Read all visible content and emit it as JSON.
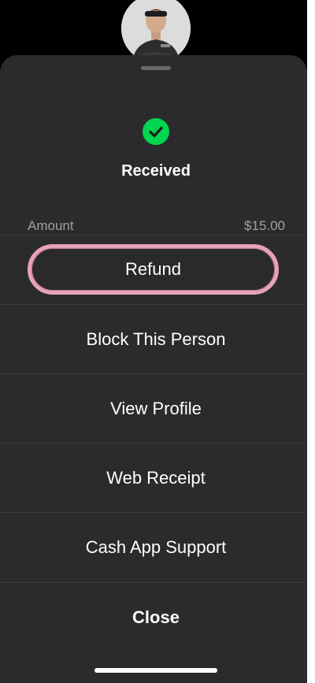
{
  "status": {
    "title": "Received",
    "icon": "check-circle-icon",
    "accent_color": "#00d64f"
  },
  "amount": {
    "label": "Amount",
    "value": "$15.00"
  },
  "actions": {
    "refund": "Refund",
    "block": "Block This Person",
    "view_profile": "View Profile",
    "web_receipt": "Web Receipt",
    "support": "Cash App Support",
    "close": "Close"
  },
  "colors": {
    "sheet_bg": "#2b2b2d",
    "refund_outline": "#e6a3b7"
  }
}
